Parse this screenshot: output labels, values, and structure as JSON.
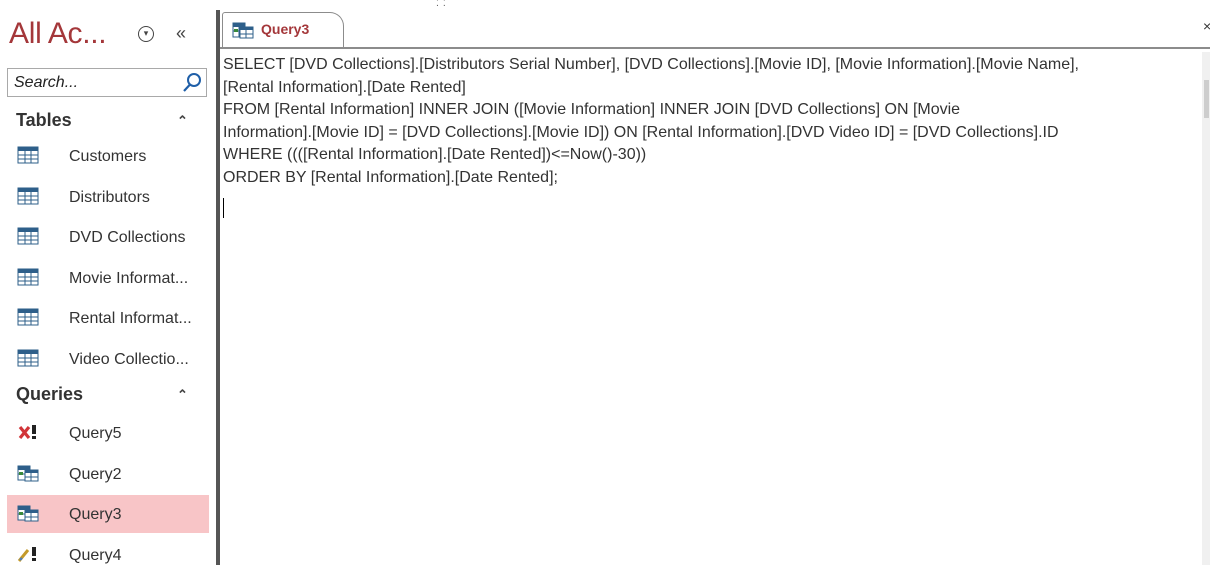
{
  "nav": {
    "title": "All Ac...",
    "search_placeholder": "Search...",
    "groups": [
      {
        "label": "Tables",
        "items": [
          {
            "label": "Customers",
            "icon": "table-icon"
          },
          {
            "label": "Distributors",
            "icon": "table-icon"
          },
          {
            "label": "DVD Collections",
            "icon": "table-icon"
          },
          {
            "label": "Movie Informat...",
            "icon": "table-icon"
          },
          {
            "label": "Rental Informat...",
            "icon": "table-icon"
          },
          {
            "label": "Video Collectio...",
            "icon": "table-icon"
          }
        ]
      },
      {
        "label": "Queries",
        "items": [
          {
            "label": "Query5",
            "icon": "delete-query-icon"
          },
          {
            "label": "Query2",
            "icon": "select-query-icon"
          },
          {
            "label": "Query3",
            "icon": "select-query-icon",
            "selected": true
          },
          {
            "label": "Query4",
            "icon": "update-query-icon"
          }
        ]
      }
    ]
  },
  "document": {
    "tab_label": "Query3",
    "sql_lines": [
      "SELECT [DVD Collections].[Distributors Serial Number], [DVD Collections].[Movie ID], [Movie Information].[Movie Name],",
      "[Rental Information].[Date Rented]",
      "FROM [Rental Information] INNER JOIN ([Movie Information] INNER JOIN [DVD Collections] ON [Movie",
      "Information].[Movie ID] = [DVD Collections].[Movie ID]) ON [Rental Information].[DVD Video ID] = [DVD Collections].ID",
      "WHERE ((([Rental Information].[Date Rented])<=Now()-30))",
      "ORDER BY [Rental Information].[Date Rented];"
    ]
  },
  "colors": {
    "accent": "#a4373a",
    "selected_bg": "#f8c5c7"
  }
}
